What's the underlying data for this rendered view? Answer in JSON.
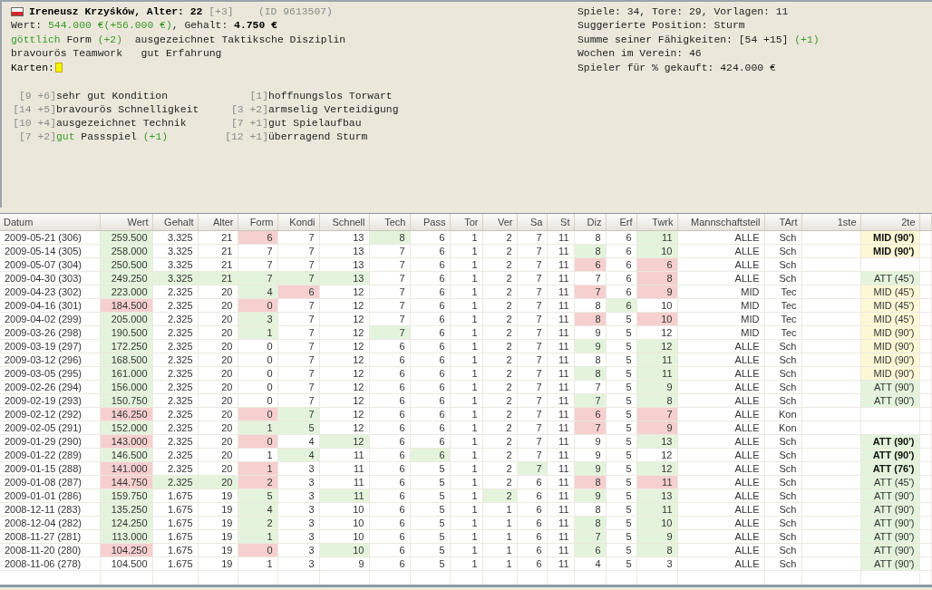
{
  "player": {
    "header_lines": [
      [
        {
          "text": "Ireneusz Krzyśków, Alter: 22 ",
          "kind": "bold"
        },
        {
          "text": "[+3]",
          "kind": "gray"
        },
        {
          "text": "    (ID 9613507)",
          "kind": "gray"
        }
      ],
      [
        {
          "text": "Wert: ",
          "kind": "plain"
        },
        {
          "text": "544.000 €",
          "kind": "green"
        },
        {
          "text": "(+56.000 €)",
          "kind": "green"
        },
        {
          "text": ", Gehalt: ",
          "kind": "plain"
        },
        {
          "text": "4.750 €",
          "kind": "bold"
        }
      ],
      [
        {
          "text": "göttlich",
          "kind": "green"
        },
        {
          "text": " Form ",
          "kind": "plain"
        },
        {
          "text": "(+2)",
          "kind": "green"
        },
        {
          "text": "  ausgezeichnet Taktiksche Disziplin",
          "kind": "plain"
        }
      ],
      [
        {
          "text": "bravourös Teamwork   gut Erfahrung",
          "kind": "plain"
        }
      ]
    ],
    "cards_label": "Karten:",
    "skills": [
      {
        "bracket": "[9 +6]",
        "parts": [
          {
            "text": "sehr gut Kondition",
            "kind": "plain"
          }
        ],
        "bracket_2": "[1]",
        "parts_2": [
          {
            "text": "hoffnungslos Torwart",
            "kind": "plain"
          }
        ]
      },
      {
        "bracket": "[14 +5]",
        "parts": [
          {
            "text": "bravourös Schnelligkeit",
            "kind": "plain"
          }
        ],
        "bracket_2": "[3 +2]",
        "parts_2": [
          {
            "text": "armselig Verteidigung",
            "kind": "plain"
          }
        ]
      },
      {
        "bracket": "[10 +4]",
        "parts": [
          {
            "text": "ausgezeichnet Technik",
            "kind": "plain"
          }
        ],
        "bracket_2": "[7 +1]",
        "parts_2": [
          {
            "text": "gut Spielaufbau",
            "kind": "plain"
          }
        ]
      },
      {
        "bracket": "[7 +2]",
        "parts": [
          {
            "text": "gut",
            "kind": "green"
          },
          {
            "text": " Passspiel ",
            "kind": "plain"
          },
          {
            "text": "(+1)",
            "kind": "green"
          }
        ],
        "bracket_2": "[12 +1]",
        "parts_2": [
          {
            "text": "überragend Sturm",
            "kind": "plain"
          }
        ]
      }
    ],
    "stats_lines": [
      [
        {
          "text": "Spiele: 34, Tore: 29, Vorlagen: 11",
          "kind": "plain"
        }
      ],
      [
        {
          "text": "Suggerierte Position: Sturm",
          "kind": "plain"
        }
      ],
      [
        {
          "text": "Summe seiner Fähigkeiten: [54 +15] ",
          "kind": "plain"
        },
        {
          "text": "(+1)",
          "kind": "green"
        }
      ],
      [
        {
          "text": "Wochen im Verein: 46",
          "kind": "plain"
        }
      ],
      [
        {
          "text": "Spieler für % gekauft: 424.000 €",
          "kind": "plain"
        }
      ]
    ]
  },
  "table": {
    "columns": [
      "Datum",
      "Wert",
      "Gehalt",
      "Alter",
      "Form",
      "Kondi",
      "Schnell",
      "Tech",
      "Pass",
      "Tor",
      "Ver",
      "Sa",
      "St",
      "Diz",
      "Erf",
      "Twrk",
      "Mannschaftsteil",
      "TArt",
      "1ste",
      "2te"
    ],
    "rows": [
      {
        "cells": [
          "2009-05-21 (306)",
          {
            "text": "259.500",
            "color": "#e4f4dc"
          },
          "3.325",
          "21",
          {
            "text": "6",
            "color": "#f6cfcf"
          },
          "7",
          "13",
          {
            "text": "8",
            "color": "#e4f4dc"
          },
          "6",
          "1",
          "2",
          "7",
          "11",
          "8",
          "6",
          {
            "text": "11",
            "color": "#e4f4dc"
          },
          "ALLE",
          "Sch",
          null,
          {
            "text": "MID (90')",
            "color": "#fcf8d6",
            "bold": true
          }
        ]
      },
      {
        "cells": [
          "2009-05-14 (305)",
          {
            "text": "258.000",
            "color": "#e4f4dc"
          },
          "3.325",
          "21",
          "7",
          "7",
          "13",
          "7",
          "6",
          "1",
          "2",
          "7",
          "11",
          {
            "text": "8",
            "color": "#e4f4dc"
          },
          "6",
          {
            "text": "10",
            "color": "#e4f4dc"
          },
          "ALLE",
          "Sch",
          null,
          {
            "text": "MID (90')",
            "color": "#fcf8d6",
            "bold": true
          }
        ]
      },
      {
        "cells": [
          "2009-05-07 (304)",
          {
            "text": "250.500",
            "color": "#e4f4dc"
          },
          "3.325",
          "21",
          "7",
          "7",
          "13",
          "7",
          "6",
          "1",
          "2",
          "7",
          "11",
          {
            "text": "6",
            "color": "#f6cfcf"
          },
          "6",
          {
            "text": "6",
            "color": "#f6cfcf"
          },
          "ALLE",
          "Sch",
          null,
          null
        ]
      },
      {
        "cells": [
          "2009-04-30 (303)",
          {
            "text": "249.250",
            "color": "#e4f4dc"
          },
          {
            "text": "3.325",
            "color": "#e4f4dc"
          },
          {
            "text": "21",
            "color": "#e4f4dc"
          },
          {
            "text": "7",
            "color": "#e4f4dc"
          },
          {
            "text": "7",
            "color": "#e4f4dc"
          },
          {
            "text": "13",
            "color": "#e4f4dc"
          },
          "7",
          "6",
          "1",
          "2",
          "7",
          "11",
          "7",
          "6",
          {
            "text": "8",
            "color": "#f6cfcf"
          },
          "ALLE",
          "Sch",
          null,
          {
            "text": "ATT (45')",
            "color": "#e4f4dc"
          }
        ]
      },
      {
        "cells": [
          "2009-04-23 (302)",
          {
            "text": "223.000",
            "color": "#e4f4dc"
          },
          "2.325",
          "20",
          {
            "text": "4",
            "color": "#e4f4dc"
          },
          {
            "text": "6",
            "color": "#f6cfcf"
          },
          "12",
          "7",
          "6",
          "1",
          "2",
          "7",
          "11",
          {
            "text": "7",
            "color": "#f6cfcf"
          },
          "6",
          {
            "text": "9",
            "color": "#f6cfcf"
          },
          "MID",
          "Tec",
          null,
          {
            "text": "MID (45')",
            "color": "#fcf8d6"
          }
        ]
      },
      {
        "cells": [
          "2009-04-16 (301)",
          {
            "text": "184.500",
            "color": "#f6cfcf"
          },
          "2.325",
          "20",
          {
            "text": "0",
            "color": "#f6cfcf"
          },
          "7",
          "12",
          "7",
          "6",
          "1",
          "2",
          "7",
          "11",
          "8",
          {
            "text": "6",
            "color": "#e4f4dc"
          },
          "10",
          "MID",
          "Tec",
          null,
          {
            "text": "MID (45')",
            "color": "#fcf8d6"
          }
        ]
      },
      {
        "cells": [
          "2009-04-02 (299)",
          {
            "text": "205.000",
            "color": "#e4f4dc"
          },
          "2.325",
          "20",
          {
            "text": "3",
            "color": "#e4f4dc"
          },
          "7",
          "12",
          "7",
          "6",
          "1",
          "2",
          "7",
          "11",
          {
            "text": "8",
            "color": "#f6cfcf"
          },
          "5",
          {
            "text": "10",
            "color": "#f6cfcf"
          },
          "MID",
          "Tec",
          null,
          {
            "text": "MID (45')",
            "color": "#fcf8d6"
          }
        ]
      },
      {
        "cells": [
          "2009-03-26 (298)",
          {
            "text": "190.500",
            "color": "#e4f4dc"
          },
          "2.325",
          "20",
          {
            "text": "1",
            "color": "#e4f4dc"
          },
          "7",
          "12",
          {
            "text": "7",
            "color": "#e4f4dc"
          },
          "6",
          "1",
          "2",
          "7",
          "11",
          "9",
          "5",
          "12",
          "MID",
          "Tec",
          null,
          {
            "text": "MID (90')",
            "color": "#fcf8d6"
          }
        ]
      },
      {
        "cells": [
          "2009-03-19 (297)",
          {
            "text": "172.250",
            "color": "#e4f4dc"
          },
          "2.325",
          "20",
          "0",
          "7",
          "12",
          "6",
          "6",
          "1",
          "2",
          "7",
          "11",
          {
            "text": "9",
            "color": "#e4f4dc"
          },
          "5",
          {
            "text": "12",
            "color": "#e4f4dc"
          },
          "ALLE",
          "Sch",
          null,
          {
            "text": "MID (90')",
            "color": "#fcf8d6"
          }
        ]
      },
      {
        "cells": [
          "2009-03-12 (296)",
          {
            "text": "168.500",
            "color": "#e4f4dc"
          },
          "2.325",
          "20",
          "0",
          "7",
          "12",
          "6",
          "6",
          "1",
          "2",
          "7",
          "11",
          "8",
          "5",
          {
            "text": "11",
            "color": "#e4f4dc"
          },
          "ALLE",
          "Sch",
          null,
          {
            "text": "MID (90')",
            "color": "#fcf8d6"
          }
        ]
      },
      {
        "cells": [
          "2009-03-05 (295)",
          {
            "text": "161.000",
            "color": "#e4f4dc"
          },
          "2.325",
          "20",
          "0",
          "7",
          "12",
          "6",
          "6",
          "1",
          "2",
          "7",
          "11",
          {
            "text": "8",
            "color": "#e4f4dc"
          },
          "5",
          {
            "text": "11",
            "color": "#e4f4dc"
          },
          "ALLE",
          "Sch",
          null,
          {
            "text": "MID (90')",
            "color": "#fcf8d6"
          }
        ]
      },
      {
        "cells": [
          "2009-02-26 (294)",
          {
            "text": "156.000",
            "color": "#e4f4dc"
          },
          "2.325",
          "20",
          "0",
          "7",
          "12",
          "6",
          "6",
          "1",
          "2",
          "7",
          "11",
          "7",
          "5",
          {
            "text": "9",
            "color": "#e4f4dc"
          },
          "ALLE",
          "Sch",
          null,
          {
            "text": "ATT (90')",
            "color": "#e4f4dc"
          }
        ]
      },
      {
        "cells": [
          "2009-02-19 (293)",
          {
            "text": "150.750",
            "color": "#e4f4dc"
          },
          "2.325",
          "20",
          "0",
          "7",
          "12",
          "6",
          "6",
          "1",
          "2",
          "7",
          "11",
          {
            "text": "7",
            "color": "#e4f4dc"
          },
          "5",
          {
            "text": "8",
            "color": "#e4f4dc"
          },
          "ALLE",
          "Sch",
          null,
          {
            "text": "ATT (90')",
            "color": "#e4f4dc"
          }
        ]
      },
      {
        "cells": [
          "2009-02-12 (292)",
          {
            "text": "146.250",
            "color": "#f6cfcf"
          },
          "2.325",
          "20",
          {
            "text": "0",
            "color": "#f6cfcf"
          },
          {
            "text": "7",
            "color": "#e4f4dc"
          },
          "12",
          "6",
          "6",
          "1",
          "2",
          "7",
          "11",
          {
            "text": "6",
            "color": "#f6cfcf"
          },
          "5",
          {
            "text": "7",
            "color": "#f6cfcf"
          },
          "ALLE",
          "Kon",
          null,
          null
        ]
      },
      {
        "cells": [
          "2009-02-05 (291)",
          {
            "text": "152.000",
            "color": "#e4f4dc"
          },
          "2.325",
          "20",
          {
            "text": "1",
            "color": "#e4f4dc"
          },
          {
            "text": "5",
            "color": "#e4f4dc"
          },
          "12",
          "6",
          "6",
          "1",
          "2",
          "7",
          "11",
          {
            "text": "7",
            "color": "#f6cfcf"
          },
          "5",
          {
            "text": "9",
            "color": "#f6cfcf"
          },
          "ALLE",
          "Kon",
          null,
          null
        ]
      },
      {
        "cells": [
          "2009-01-29 (290)",
          {
            "text": "143.000",
            "color": "#f6cfcf"
          },
          "2.325",
          "20",
          {
            "text": "0",
            "color": "#f6cfcf"
          },
          "4",
          {
            "text": "12",
            "color": "#e4f4dc"
          },
          "6",
          "6",
          "1",
          "2",
          "7",
          "11",
          "9",
          "5",
          {
            "text": "13",
            "color": "#e4f4dc"
          },
          "ALLE",
          "Sch",
          null,
          {
            "text": "ATT (90')",
            "color": "#e4f4dc",
            "bold": true
          }
        ]
      },
      {
        "cells": [
          "2009-01-22 (289)",
          {
            "text": "146.500",
            "color": "#e4f4dc"
          },
          "2.325",
          "20",
          "1",
          {
            "text": "4",
            "color": "#e4f4dc"
          },
          "11",
          "6",
          {
            "text": "6",
            "color": "#e4f4dc"
          },
          "1",
          "2",
          "7",
          "11",
          "9",
          "5",
          "12",
          "ALLE",
          "Sch",
          null,
          {
            "text": "ATT (90')",
            "color": "#e4f4dc",
            "bold": true
          }
        ]
      },
      {
        "cells": [
          "2009-01-15 (288)",
          {
            "text": "141.000",
            "color": "#f6cfcf"
          },
          "2.325",
          "20",
          {
            "text": "1",
            "color": "#f6cfcf"
          },
          "3",
          "11",
          "6",
          "5",
          "1",
          "2",
          {
            "text": "7",
            "color": "#e4f4dc"
          },
          "11",
          {
            "text": "9",
            "color": "#e4f4dc"
          },
          "5",
          {
            "text": "12",
            "color": "#e4f4dc"
          },
          "ALLE",
          "Sch",
          null,
          {
            "text": "ATT (76')",
            "color": "#e4f4dc",
            "bold": true
          }
        ]
      },
      {
        "cells": [
          "2009-01-08 (287)",
          {
            "text": "144.750",
            "color": "#f6cfcf"
          },
          {
            "text": "2.325",
            "color": "#e4f4dc"
          },
          {
            "text": "20",
            "color": "#e4f4dc"
          },
          {
            "text": "2",
            "color": "#f6cfcf"
          },
          "3",
          "11",
          "6",
          "5",
          "1",
          "2",
          "6",
          "11",
          {
            "text": "8",
            "color": "#f6cfcf"
          },
          "5",
          {
            "text": "11",
            "color": "#f6cfcf"
          },
          "ALLE",
          "Sch",
          null,
          {
            "text": "ATT (45')",
            "color": "#e4f4dc"
          }
        ]
      },
      {
        "cells": [
          "2009-01-01 (286)",
          {
            "text": "159.750",
            "color": "#e4f4dc"
          },
          "1.675",
          "19",
          {
            "text": "5",
            "color": "#e4f4dc"
          },
          "3",
          {
            "text": "11",
            "color": "#e4f4dc"
          },
          "6",
          "5",
          "1",
          {
            "text": "2",
            "color": "#e4f4dc"
          },
          "6",
          "11",
          {
            "text": "9",
            "color": "#e4f4dc"
          },
          "5",
          {
            "text": "13",
            "color": "#e4f4dc"
          },
          "ALLE",
          "Sch",
          null,
          {
            "text": "ATT (90')",
            "color": "#e4f4dc"
          }
        ]
      },
      {
        "cells": [
          "2008-12-11 (283)",
          {
            "text": "135.250",
            "color": "#e4f4dc"
          },
          "1.675",
          "19",
          {
            "text": "4",
            "color": "#e4f4dc"
          },
          "3",
          "10",
          "6",
          "5",
          "1",
          "1",
          "6",
          "11",
          "8",
          "5",
          {
            "text": "11",
            "color": "#e4f4dc"
          },
          "ALLE",
          "Sch",
          null,
          {
            "text": "ATT (90')",
            "color": "#e4f4dc"
          }
        ]
      },
      {
        "cells": [
          "2008-12-04 (282)",
          {
            "text": "124.250",
            "color": "#e4f4dc"
          },
          "1.675",
          "19",
          {
            "text": "2",
            "color": "#e4f4dc"
          },
          "3",
          "10",
          "6",
          "5",
          "1",
          "1",
          "6",
          "11",
          {
            "text": "8",
            "color": "#e4f4dc"
          },
          "5",
          {
            "text": "10",
            "color": "#e4f4dc"
          },
          "ALLE",
          "Sch",
          null,
          {
            "text": "ATT (90')",
            "color": "#e4f4dc"
          }
        ]
      },
      {
        "cells": [
          "2008-11-27 (281)",
          {
            "text": "113.000",
            "color": "#e4f4dc"
          },
          "1.675",
          "19",
          {
            "text": "1",
            "color": "#e4f4dc"
          },
          "3",
          "10",
          "6",
          "5",
          "1",
          "1",
          "6",
          "11",
          {
            "text": "7",
            "color": "#e4f4dc"
          },
          "5",
          {
            "text": "9",
            "color": "#e4f4dc"
          },
          "ALLE",
          "Sch",
          null,
          {
            "text": "ATT (90')",
            "color": "#e4f4dc"
          }
        ]
      },
      {
        "cells": [
          "2008-11-20 (280)",
          {
            "text": "104.250",
            "color": "#f6cfcf"
          },
          "1.675",
          "19",
          {
            "text": "0",
            "color": "#f6cfcf"
          },
          "3",
          {
            "text": "10",
            "color": "#e4f4dc"
          },
          "6",
          "5",
          "1",
          "1",
          "6",
          "11",
          {
            "text": "6",
            "color": "#e4f4dc"
          },
          "5",
          {
            "text": "8",
            "color": "#e4f4dc"
          },
          "ALLE",
          "Sch",
          null,
          {
            "text": "ATT (90')",
            "color": "#e4f4dc"
          }
        ]
      },
      {
        "cells": [
          "2008-11-06 (278)",
          "104.500",
          "1.675",
          "19",
          "1",
          "3",
          "9",
          "6",
          "5",
          "1",
          "1",
          "6",
          "11",
          "4",
          "5",
          "3",
          "ALLE",
          "Sch",
          null,
          {
            "text": "ATT (90')",
            "color": "#e4f4dc"
          }
        ]
      }
    ]
  }
}
